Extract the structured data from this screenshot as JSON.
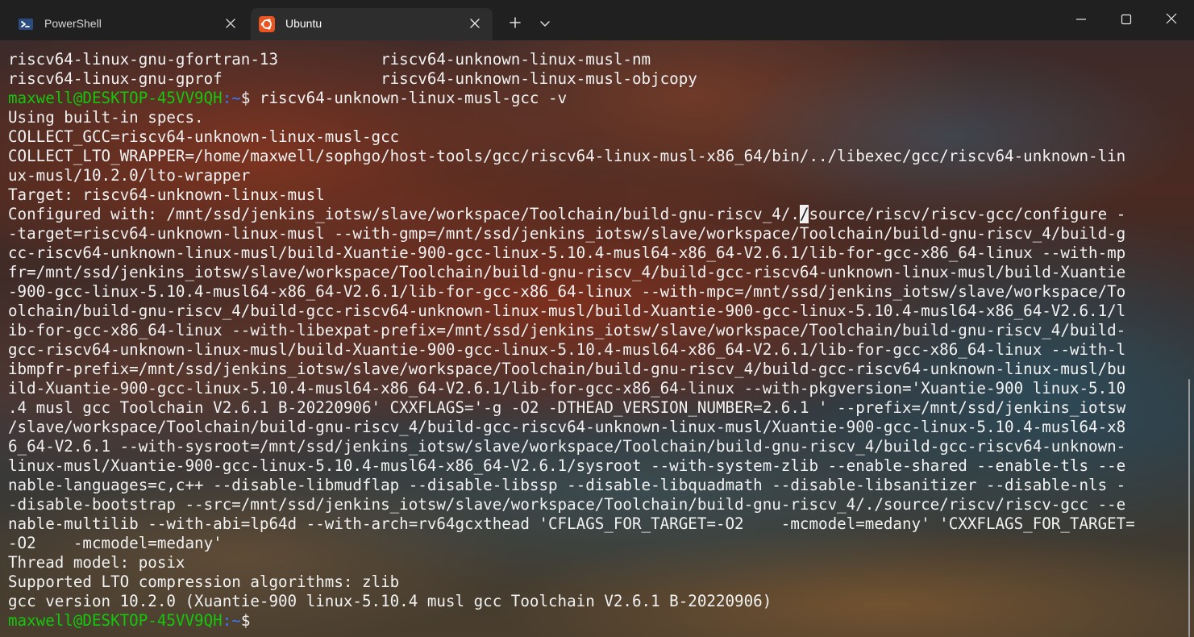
{
  "tabs": [
    {
      "label": "PowerShell",
      "icon": "powershell-icon",
      "active": false
    },
    {
      "label": "Ubuntu",
      "icon": "ubuntu-icon",
      "active": true
    }
  ],
  "tabbar": {
    "new_tab_icon": "plus-icon",
    "dropdown_icon": "chevron-down-icon"
  },
  "window_controls": {
    "minimize_icon": "minimize-icon",
    "maximize_icon": "maximize-icon",
    "close_icon": "close-icon"
  },
  "colors": {
    "prompt_user": "#16c60c",
    "prompt_path": "#3b78ff",
    "text": "#f2f2f2",
    "tab_active_bg": "#2d2d2d",
    "tabbar_bg": "#202020",
    "ubuntu_brand": "#e95420"
  },
  "terminal": {
    "lines": [
      {
        "text": "riscv64-linux-gnu-gfortran-13           riscv64-unknown-linux-musl-nm"
      },
      {
        "text": "riscv64-linux-gnu-gprof                 riscv64-unknown-linux-musl-objcopy"
      },
      {
        "prompt_user": "maxwell@DESKTOP-45VV9QH",
        "prompt_path": ":~",
        "text": "$ riscv64-unknown-linux-musl-gcc -v"
      },
      {
        "text": "Using built-in specs."
      },
      {
        "text": "COLLECT_GCC=riscv64-unknown-linux-musl-gcc"
      },
      {
        "text": "COLLECT_LTO_WRAPPER=/home/maxwell/sophgo/host-tools/gcc/riscv64-linux-musl-x86_64/bin/../libexec/gcc/riscv64-unknown-lin"
      },
      {
        "text": "ux-musl/10.2.0/lto-wrapper"
      },
      {
        "text": "Target: riscv64-unknown-linux-musl"
      },
      {
        "text": "Configured with: /mnt/ssd/jenkins_iotsw/slave/workspace/Toolchain/build-gnu-riscv_4/./source/riscv/riscv-gcc/configure -",
        "cursor_after": "Configured with: /mnt/ssd/jenkins_iotsw/slave/workspace/Toolchain/build-gnu-riscv_4/.",
        "cursor_char": "/",
        "cursor_rest": "source/riscv/riscv-gcc/configure -"
      },
      {
        "text": "-target=riscv64-unknown-linux-musl --with-gmp=/mnt/ssd/jenkins_iotsw/slave/workspace/Toolchain/build-gnu-riscv_4/build-g"
      },
      {
        "text": "cc-riscv64-unknown-linux-musl/build-Xuantie-900-gcc-linux-5.10.4-musl64-x86_64-V2.6.1/lib-for-gcc-x86_64-linux --with-mp"
      },
      {
        "text": "fr=/mnt/ssd/jenkins_iotsw/slave/workspace/Toolchain/build-gnu-riscv_4/build-gcc-riscv64-unknown-linux-musl/build-Xuantie"
      },
      {
        "text": "-900-gcc-linux-5.10.4-musl64-x86_64-V2.6.1/lib-for-gcc-x86_64-linux --with-mpc=/mnt/ssd/jenkins_iotsw/slave/workspace/To"
      },
      {
        "text": "olchain/build-gnu-riscv_4/build-gcc-riscv64-unknown-linux-musl/build-Xuantie-900-gcc-linux-5.10.4-musl64-x86_64-V2.6.1/l"
      },
      {
        "text": "ib-for-gcc-x86_64-linux --with-libexpat-prefix=/mnt/ssd/jenkins_iotsw/slave/workspace/Toolchain/build-gnu-riscv_4/build-"
      },
      {
        "text": "gcc-riscv64-unknown-linux-musl/build-Xuantie-900-gcc-linux-5.10.4-musl64-x86_64-V2.6.1/lib-for-gcc-x86_64-linux --with-l"
      },
      {
        "text": "ibmpfr-prefix=/mnt/ssd/jenkins_iotsw/slave/workspace/Toolchain/build-gnu-riscv_4/build-gcc-riscv64-unknown-linux-musl/bu"
      },
      {
        "text": "ild-Xuantie-900-gcc-linux-5.10.4-musl64-x86_64-V2.6.1/lib-for-gcc-x86_64-linux --with-pkgversion='Xuantie-900 linux-5.10"
      },
      {
        "text": ".4 musl gcc Toolchain V2.6.1 B-20220906' CXXFLAGS='-g -O2 -DTHEAD_VERSION_NUMBER=2.6.1 ' --prefix=/mnt/ssd/jenkins_iotsw"
      },
      {
        "text": "/slave/workspace/Toolchain/build-gnu-riscv_4/build-gcc-riscv64-unknown-linux-musl/Xuantie-900-gcc-linux-5.10.4-musl64-x8"
      },
      {
        "text": "6_64-V2.6.1 --with-sysroot=/mnt/ssd/jenkins_iotsw/slave/workspace/Toolchain/build-gnu-riscv_4/build-gcc-riscv64-unknown-"
      },
      {
        "text": "linux-musl/Xuantie-900-gcc-linux-5.10.4-musl64-x86_64-V2.6.1/sysroot --with-system-zlib --enable-shared --enable-tls --e"
      },
      {
        "text": "nable-languages=c,c++ --disable-libmudflap --disable-libssp --disable-libquadmath --disable-libsanitizer --disable-nls -"
      },
      {
        "text": "-disable-bootstrap --src=/mnt/ssd/jenkins_iotsw/slave/workspace/Toolchain/build-gnu-riscv_4/./source/riscv/riscv-gcc --e"
      },
      {
        "text": "nable-multilib --with-abi=lp64d --with-arch=rv64gcxthead 'CFLAGS_FOR_TARGET=-O2    -mcmodel=medany' 'CXXFLAGS_FOR_TARGET="
      },
      {
        "text": "-O2    -mcmodel=medany'"
      },
      {
        "text": "Thread model: posix"
      },
      {
        "text": "Supported LTO compression algorithms: zlib"
      },
      {
        "text": "gcc version 10.2.0 (Xuantie-900 linux-5.10.4 musl gcc Toolchain V2.6.1 B-20220906)"
      },
      {
        "prompt_user": "maxwell@DESKTOP-45VV9QH",
        "prompt_path": ":~",
        "text": "$"
      }
    ]
  }
}
